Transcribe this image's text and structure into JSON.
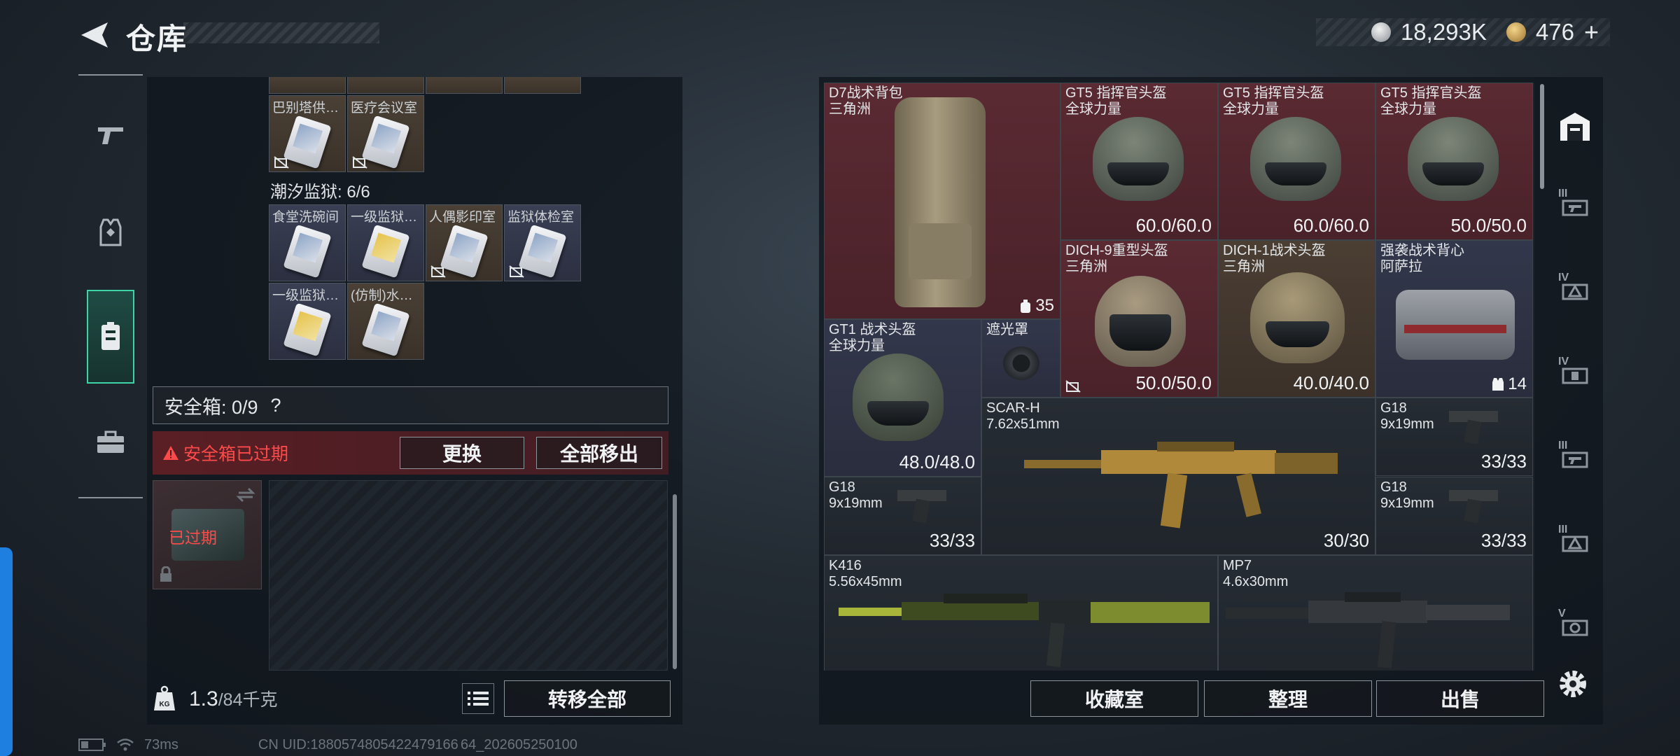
{
  "header": {
    "title": "仓库"
  },
  "currency": {
    "silver": "18,293K",
    "gold": "476",
    "plus": "+"
  },
  "left_panel": {
    "row_top": [
      {
        "label": "巴别塔供…",
        "tint": "gold"
      },
      {
        "label": "医疗会议室",
        "tint": "gold"
      }
    ],
    "group_label": "潮汐监狱: 6/6",
    "group_row1": [
      {
        "label": "食堂洗碗间",
        "tint": "blue"
      },
      {
        "label": "一级监狱…",
        "tint": "blue"
      },
      {
        "label": "人偶影印室",
        "tint": "gold"
      },
      {
        "label": "监狱体检室",
        "tint": "blue"
      }
    ],
    "group_row2": [
      {
        "label": "一级监狱…",
        "tint": "blue"
      },
      {
        "label": "(仿制)水…",
        "tint": "gold"
      }
    ],
    "safebox": {
      "label": "安全箱: 0/9",
      "help": "?"
    },
    "expired": {
      "text": "安全箱已过期",
      "replace_button": "更换",
      "remove_all_button": "全部移出",
      "thumb_label": "已过期"
    },
    "weight": {
      "current": "1.3",
      "max": "/84千克",
      "icon": "KG"
    },
    "transfer_all_button": "转移全部"
  },
  "stash": {
    "items": [
      {
        "name": "D7战术背包",
        "sub": "三角洲",
        "count": "35"
      },
      {
        "name": "GT5 指挥官头盔",
        "sub": "全球力量",
        "durability": "60.0/60.0"
      },
      {
        "name": "GT5 指挥官头盔",
        "sub": "全球力量",
        "durability": "60.0/60.0"
      },
      {
        "name": "GT5 指挥官头盔",
        "sub": "全球力量",
        "durability": "50.0/50.0"
      },
      {
        "name": "DICH-9重型头盔",
        "sub": "三角洲",
        "durability": "50.0/50.0"
      },
      {
        "name": "DICH-1战术头盔",
        "sub": "三角洲",
        "durability": "40.0/40.0"
      },
      {
        "name": "强袭战术背心",
        "sub": "阿萨拉",
        "count": "14"
      },
      {
        "name": "GT1 战术头盔",
        "sub": "全球力量",
        "durability": "48.0/48.0"
      },
      {
        "name": "遮光罩",
        "sub": ""
      },
      {
        "name": "SCAR-H",
        "sub": "7.62x51mm",
        "ammo": "30/30"
      },
      {
        "name": "G18",
        "sub": "9x19mm",
        "ammo": "33/33"
      },
      {
        "name": "G18",
        "sub": "9x19mm",
        "ammo": "33/33"
      },
      {
        "name": "G18",
        "sub": "9x19mm",
        "ammo": "33/33"
      },
      {
        "name": "K416",
        "sub": "5.56x45mm"
      },
      {
        "name": "MP7",
        "sub": "4.6x30mm"
      }
    ],
    "buttons": {
      "collection": "收藏室",
      "sort": "整理",
      "sell": "出售"
    }
  },
  "right_tabs": {
    "levels": [
      "III",
      "IV",
      "IV",
      "III",
      "III",
      "V"
    ]
  },
  "footer": {
    "ping": "73ms",
    "uid": "CN UID:1880574805422479166 64_202605250100"
  },
  "colors": {
    "accent": "#3fd4a6",
    "expired": "#ff4a4a",
    "rare_red": "#5b2a33",
    "rare_blue": "#33374b",
    "rare_gold": "#4b3e33"
  }
}
